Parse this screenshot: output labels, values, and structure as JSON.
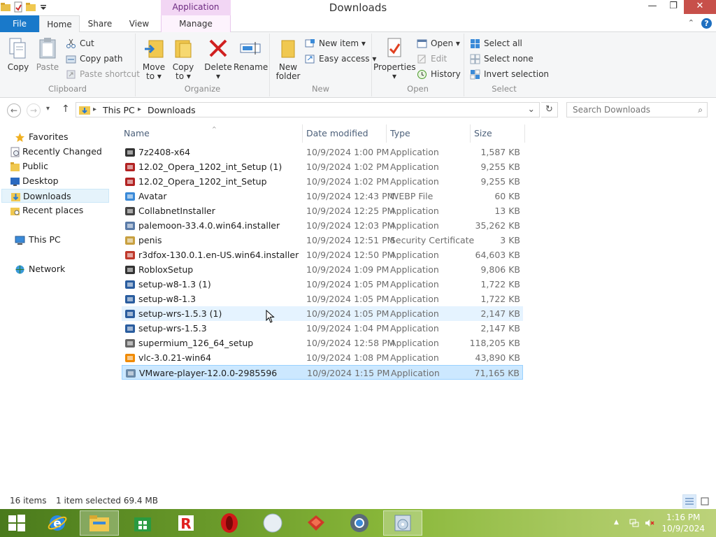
{
  "window": {
    "title": "Downloads",
    "context_tab_header": "Application Tools",
    "minimize": "—",
    "maximize": "❐",
    "close": "✕"
  },
  "tabs": {
    "file": "File",
    "home": "Home",
    "share": "Share",
    "view": "View",
    "manage": "Manage",
    "expand": "⌃",
    "help": "?"
  },
  "ribbon": {
    "clipboard": {
      "label": "Clipboard",
      "copy": "Copy",
      "paste": "Paste",
      "cut": "Cut",
      "copy_path": "Copy path",
      "paste_shortcut": "Paste shortcut"
    },
    "organize": {
      "label": "Organize",
      "move_to": "Move",
      "move_to_2": "to ▾",
      "copy_to": "Copy",
      "copy_to_2": "to ▾",
      "delete": "Delete",
      "delete_2": "▾",
      "rename": "Rename"
    },
    "new": {
      "label": "New",
      "new_folder": "New",
      "new_folder_2": "folder",
      "new_item": "New item ▾",
      "easy_access": "Easy access ▾"
    },
    "open": {
      "label": "Open",
      "properties": "Properties",
      "properties_2": "▾",
      "open": "Open ▾",
      "edit": "Edit",
      "history": "History"
    },
    "select": {
      "label": "Select",
      "select_all": "Select all",
      "select_none": "Select none",
      "invert": "Invert selection"
    }
  },
  "address": {
    "back": "←",
    "forward": "→",
    "recent": "▾",
    "up": "↑",
    "crumb_sep1": "▸",
    "crumb_this_pc": "This PC",
    "crumb_sep2": "▸",
    "crumb_downloads": "Downloads",
    "dropdown": "⌄",
    "refresh": "↻",
    "search_placeholder": "Search Downloads",
    "search_icon": "⌕"
  },
  "nav": {
    "favorites": "Favorites",
    "recently_changed": "Recently Changed",
    "public": "Public",
    "desktop": "Desktop",
    "downloads": "Downloads",
    "recent_places": "Recent places",
    "this_pc": "This PC",
    "network": "Network"
  },
  "columns": {
    "name": "Name",
    "date": "Date modified",
    "type": "Type",
    "size": "Size",
    "sort_indicator": "^"
  },
  "files": [
    {
      "name": "7z2408-x64",
      "date": "10/9/2024 1:00 PM",
      "type": "Application",
      "size": "1,587 KB",
      "icon": "7zip-icon",
      "color": "#333333"
    },
    {
      "name": "12.02_Opera_1202_int_Setup (1)",
      "date": "10/9/2024 1:02 PM",
      "type": "Application",
      "size": "9,255 KB",
      "icon": "opera-setup-icon",
      "color": "#b22222"
    },
    {
      "name": "12.02_Opera_1202_int_Setup",
      "date": "10/9/2024 1:02 PM",
      "type": "Application",
      "size": "9,255 KB",
      "icon": "opera-setup-icon",
      "color": "#b22222"
    },
    {
      "name": "Avatar",
      "date": "10/9/2024 12:43 PM",
      "type": "WEBP File",
      "size": "60 KB",
      "icon": "ie-file-icon",
      "color": "#3a8ad8"
    },
    {
      "name": "CollabnetInstaller",
      "date": "10/9/2024 12:25 PM",
      "type": "Application",
      "size": "13 KB",
      "icon": "collabnet-icon",
      "color": "#444444"
    },
    {
      "name": "palemoon-33.4.0.win64.installer",
      "date": "10/9/2024 12:03 PM",
      "type": "Application",
      "size": "35,262 KB",
      "icon": "installer-icon",
      "color": "#5a7ba8"
    },
    {
      "name": "penis",
      "date": "10/9/2024 12:51 PM",
      "type": "Security Certificate",
      "size": "3 KB",
      "icon": "certificate-icon",
      "color": "#c8a040"
    },
    {
      "name": "r3dfox-130.0.1.en-US.win64.installer",
      "date": "10/9/2024 12:50 PM",
      "type": "Application",
      "size": "64,603 KB",
      "icon": "r3dfox-icon",
      "color": "#c0392b"
    },
    {
      "name": "RobloxSetup",
      "date": "10/9/2024 1:09 PM",
      "type": "Application",
      "size": "9,806 KB",
      "icon": "roblox-icon",
      "color": "#333333"
    },
    {
      "name": "setup-w8-1.3 (1)",
      "date": "10/9/2024 1:05 PM",
      "type": "Application",
      "size": "1,722 KB",
      "icon": "setup-icon",
      "color": "#2a5d9f"
    },
    {
      "name": "setup-w8-1.3",
      "date": "10/9/2024 1:05 PM",
      "type": "Application",
      "size": "1,722 KB",
      "icon": "setup-icon",
      "color": "#2a5d9f"
    },
    {
      "name": "setup-wrs-1.5.3 (1)",
      "date": "10/9/2024 1:05 PM",
      "type": "Application",
      "size": "2,147 KB",
      "icon": "setup-icon",
      "color": "#2a5d9f"
    },
    {
      "name": "setup-wrs-1.5.3",
      "date": "10/9/2024 1:04 PM",
      "type": "Application",
      "size": "2,147 KB",
      "icon": "setup-icon",
      "color": "#2a5d9f"
    },
    {
      "name": "supermium_126_64_setup",
      "date": "10/9/2024 12:58 PM",
      "type": "Application",
      "size": "118,205 KB",
      "icon": "supermium-icon",
      "color": "#666666"
    },
    {
      "name": "vlc-3.0.21-win64",
      "date": "10/9/2024 1:08 PM",
      "type": "Application",
      "size": "43,890 KB",
      "icon": "vlc-icon",
      "color": "#f08a00"
    },
    {
      "name": "VMware-player-12.0.0-2985596",
      "date": "10/9/2024 1:15 PM",
      "type": "Application",
      "size": "71,165 KB",
      "icon": "vmware-icon",
      "color": "#6b8aa8"
    }
  ],
  "status": {
    "items": "16 items",
    "selected": "1 item selected  69.4 MB"
  },
  "taskbar": {
    "time": "1:16 PM",
    "date": "10/9/2024"
  },
  "colors": {
    "file_tab": "#1979ca",
    "context_tab": "#f2d6f4",
    "selection": "#cce8ff",
    "hover": "#e5f3ff"
  }
}
